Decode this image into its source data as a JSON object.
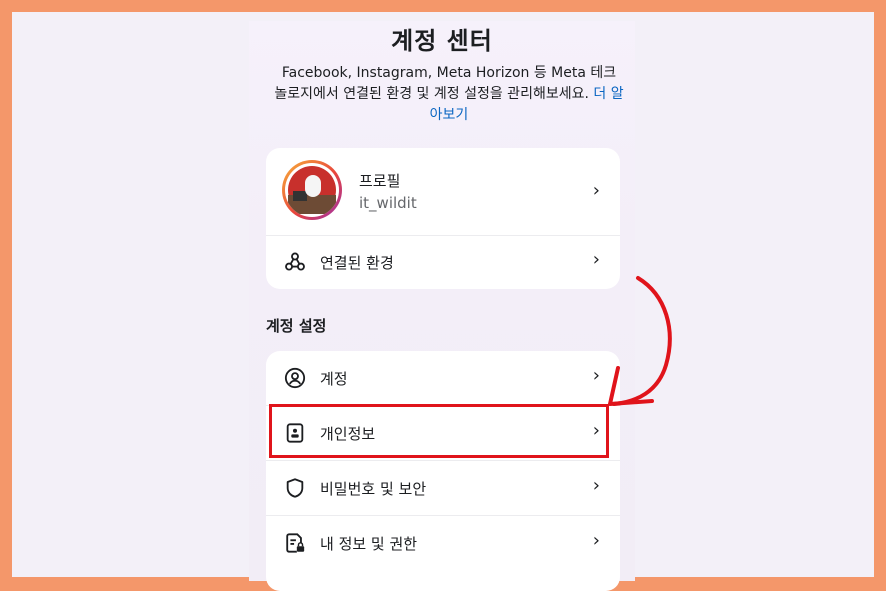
{
  "header": {
    "title": "계정 센터",
    "description_line1": "Facebook, Instagram, Meta Horizon 등 Meta 테크",
    "description_line2": "놀로지에서 연결된 환경 및 계정 설정을 관리해보세요.",
    "learn_more_part1": "더 알",
    "learn_more_part2": "아보기"
  },
  "profile_card": {
    "profile_label": "프로필",
    "username": "it_wildit",
    "connected_label": "연결된 환경"
  },
  "account_settings": {
    "section_title": "계정 설정",
    "items": [
      {
        "label": "계정",
        "icon": "person-circle-icon"
      },
      {
        "label": "개인정보",
        "icon": "id-card-icon"
      },
      {
        "label": "비밀번호 및 보안",
        "icon": "shield-icon"
      },
      {
        "label": "내 정보 및 권한",
        "icon": "document-lock-icon"
      }
    ]
  },
  "colors": {
    "accent_link": "#0a66c2",
    "annotation_red": "#e0141b",
    "outer_border": "#f4976a"
  }
}
